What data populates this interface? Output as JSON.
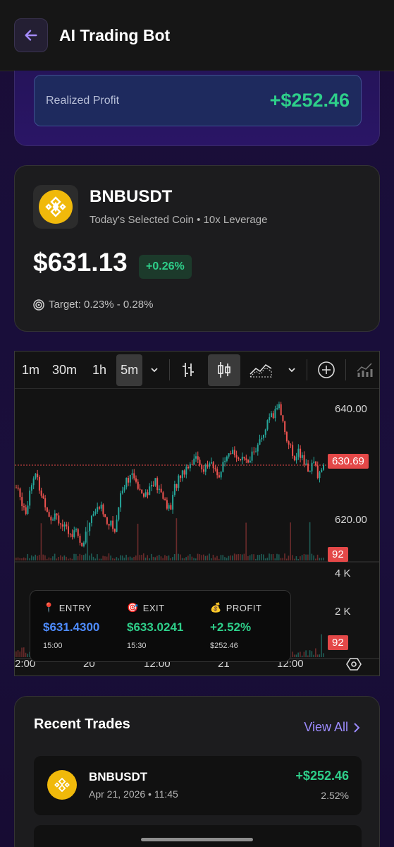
{
  "header": {
    "title": "AI Trading Bot"
  },
  "profit": {
    "label": "Realized Profit",
    "value": "+$252.46"
  },
  "coin": {
    "symbol": "BNBUSDT",
    "subtitle": "Today's Selected Coin • 10x Leverage",
    "price": "$631.13",
    "change": "+0.26%",
    "target": "Target: 0.23% - 0.28%"
  },
  "chart": {
    "timeframes": [
      "1m",
      "30m",
      "1h",
      "5m"
    ],
    "active_timeframe": "5m",
    "price_labels": [
      "640.00",
      "620.00"
    ],
    "current_price_tag": "630.69",
    "volume_tag": "92",
    "volume_labels": [
      "4 K",
      "2 K"
    ],
    "volume_tag_2": "92",
    "x_labels": [
      "2:00",
      "20",
      "12:00",
      "21",
      "12:00"
    ]
  },
  "chart_data": {
    "type": "candlestick",
    "ylim": [
      615,
      643
    ],
    "y_ticks": [
      640,
      620
    ],
    "x_tick_labels": [
      "2:00",
      "20",
      "12:00",
      "21",
      "12:00"
    ],
    "last_price": 630.69,
    "close_series": [
      627,
      625,
      623,
      628,
      629,
      626,
      624,
      622,
      623,
      621,
      620,
      619,
      621,
      617,
      619,
      622,
      623,
      624,
      622,
      621,
      620,
      626,
      628,
      629,
      628,
      627,
      626,
      627,
      628,
      626,
      625,
      623,
      627,
      629,
      630,
      631,
      632,
      631,
      630,
      631,
      630,
      629,
      631,
      632,
      633,
      632,
      631,
      632,
      633,
      634,
      636,
      638,
      639,
      641,
      637,
      634,
      632,
      633,
      631,
      630,
      631,
      629,
      630.69
    ],
    "volume_y_ticks": [
      "4 K",
      "2 K"
    ],
    "volume_last": 92
  },
  "trade": {
    "entry_label": "ENTRY",
    "entry_price": "$631.4300",
    "entry_time": "15:00",
    "exit_label": "EXIT",
    "exit_price": "$633.0241",
    "exit_time": "15:30",
    "profit_label": "PROFIT",
    "profit_pct": "+2.52%",
    "profit_amount": "$252.46"
  },
  "recent": {
    "title": "Recent Trades",
    "view_all": "View All",
    "items": [
      {
        "symbol": "BNBUSDT",
        "date": "Apr 21, 2026 • 11:45",
        "amount": "+$252.46",
        "pct": "2.52%"
      }
    ]
  },
  "colors": {
    "green": "#2ecf8a",
    "red": "#e44848",
    "accent": "#9d8cff",
    "bnb": "#f0b90b"
  }
}
